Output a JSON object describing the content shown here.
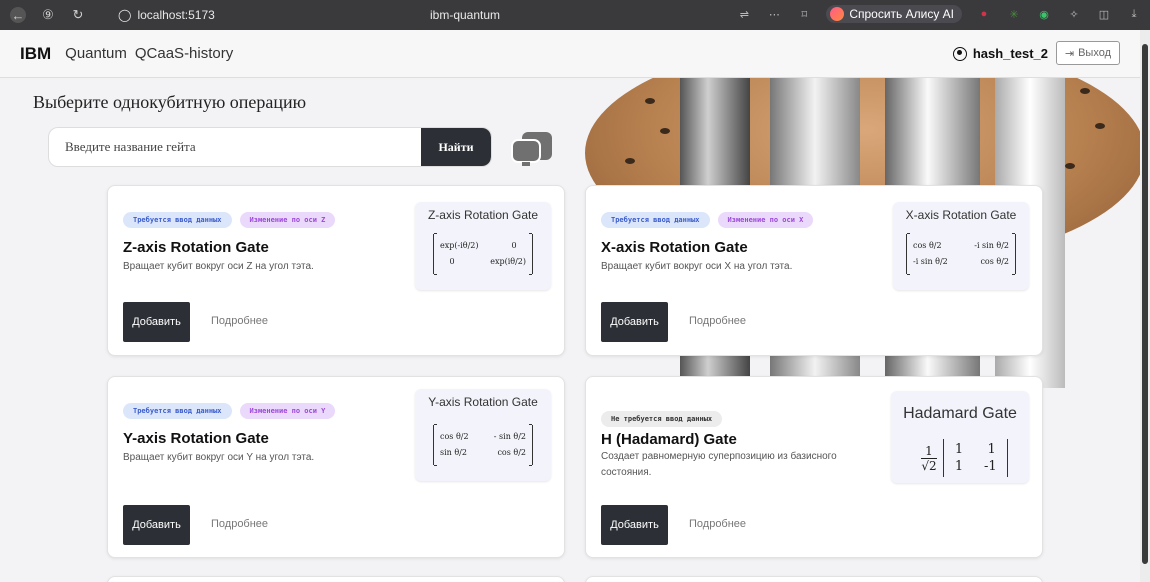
{
  "browser": {
    "url": "localhost:5173",
    "page_title": "ibm-quantum",
    "alice_label": "Спросить Алису AI"
  },
  "header": {
    "brand": "IBM",
    "nav": [
      "Quantum",
      "QCaaS-history"
    ],
    "username": "hash_test_2",
    "logout_label": "Выход"
  },
  "main": {
    "heading": "Выберите однокубитную операцию",
    "search": {
      "placeholder": "Введите название гейта",
      "button_label": "Найти"
    },
    "add_label": "Добавить",
    "details_label": "Подробнее"
  },
  "cards": [
    {
      "tags": [
        "Требуется ввод данных",
        "Изменение по оси Z"
      ],
      "title": "Z-axis Rotation Gate",
      "description": "Вращает кубит вокруг оси Z на угол тэта.",
      "matrix_title": "Z-axis Rotation Gate",
      "matrix": [
        [
          "exp(-iθ/2)",
          "0"
        ],
        [
          "0",
          "exp(iθ/2)"
        ]
      ]
    },
    {
      "tags": [
        "Требуется ввод данных",
        "Изменение по оси X"
      ],
      "title": "X-axis Rotation Gate",
      "description": "Вращает кубит вокруг оси X на угол тэта.",
      "matrix_title": "X-axis Rotation Gate",
      "matrix": [
        [
          "cos θ/2",
          "-i sin θ/2"
        ],
        [
          "-i sin θ/2",
          "cos θ/2"
        ]
      ]
    },
    {
      "tags": [
        "Требуется ввод данных",
        "Изменение по оси Y"
      ],
      "title": "Y-axis Rotation Gate",
      "description": "Вращает кубит вокруг оси Y на угол тэта.",
      "matrix_title": "Y-axis Rotation Gate",
      "matrix": [
        [
          "cos θ/2",
          "- sin θ/2"
        ],
        [
          "sin θ/2",
          "cos θ/2"
        ]
      ]
    },
    {
      "tags": [
        "Не требуется ввод данных"
      ],
      "title": "H (Hadamard) Gate",
      "description": "Создает равномерную суперпозицию из базисного состояния.",
      "matrix_title": "Hadamard Gate",
      "prefactor_num": "1",
      "prefactor_den": "√2",
      "matrix": [
        [
          "1",
          "1"
        ],
        [
          "1",
          "-1"
        ]
      ]
    }
  ]
}
